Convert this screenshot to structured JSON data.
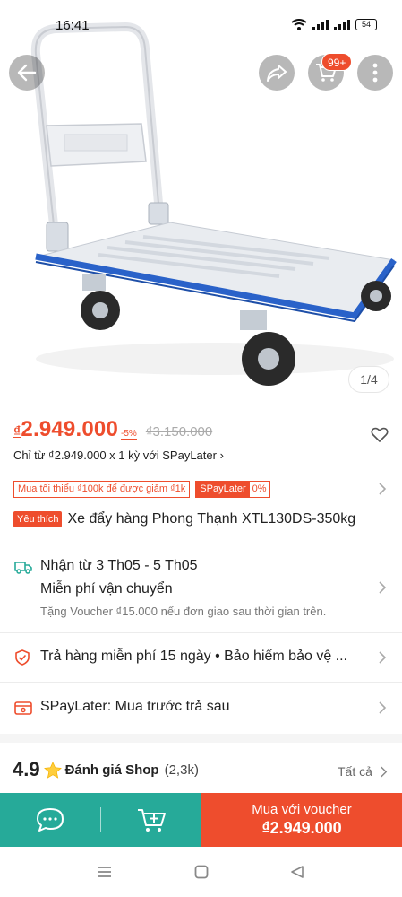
{
  "status_bar": {
    "time": "16:41",
    "battery": "54"
  },
  "header": {
    "cart_badge": "99+"
  },
  "gallery": {
    "counter": "1/4"
  },
  "price": {
    "currency_symbol": "₫",
    "current": "2.949.000",
    "old_tag": "-5%",
    "old": "₫3.150.000"
  },
  "installment": {
    "text": "Chỉ từ ₫2.949.000 x 1 kỳ với SPayLater ›"
  },
  "promo": {
    "min_order": "Mua tối thiểu ₫100k để được giảm ₫1k",
    "spaylater_label": "SPayLater",
    "spaylater_rate": "0%"
  },
  "product": {
    "fav_tag": "Yêu thích",
    "title": "Xe đẩy hàng Phong Thạnh XTL130DS-350kg"
  },
  "shipping": {
    "delivery": "Nhận từ 3 Th05 - 5 Th05",
    "free_ship": "Miễn phí vận chuyển",
    "voucher_note": "Tặng Voucher ₫15.000 nếu đơn giao sau thời gian trên."
  },
  "guarantee": {
    "text": "Trả hàng miễn phí 15 ngày  •  Bảo hiểm bảo vệ ..."
  },
  "spaylater_row": {
    "text": "SPayLater: Mua trước trả sau"
  },
  "rating": {
    "score": "4.9",
    "label": "Đánh giá Shop",
    "count": "(2,3k)",
    "see_all": "Tất cả"
  },
  "bottom_bar": {
    "buy_line1": "Mua với voucher",
    "buy_line2": "₫2.949.000"
  },
  "colors": {
    "accent": "#ee4d2d",
    "teal": "#26aa99",
    "trolley_blue": "#2a62c9"
  },
  "icons": [
    "back-icon",
    "share-icon",
    "cart-icon",
    "more-icon",
    "heart-icon",
    "truck-icon",
    "shield-icon",
    "spaylater-icon",
    "star-icon",
    "chat-icon",
    "add-to-cart-icon",
    "menu-nav-icon",
    "home-nav-icon",
    "back-nav-icon"
  ]
}
